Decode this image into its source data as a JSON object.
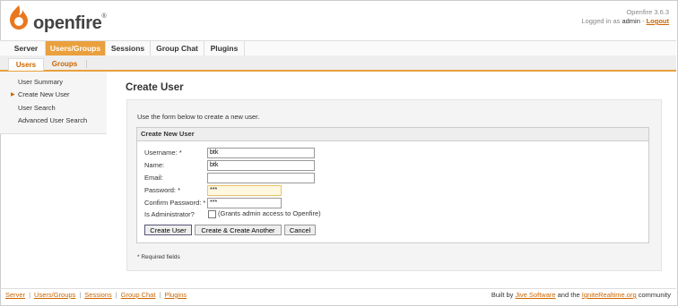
{
  "header": {
    "logo_text": "openfire",
    "logo_tm": "®",
    "version": "Openfire 3.6.3",
    "logged_in_prefix": "Logged in as",
    "user": "admin",
    "separator": "-",
    "logout": "Logout"
  },
  "tabs": [
    {
      "label": "Server"
    },
    {
      "label": "Users/Groups"
    },
    {
      "label": "Sessions"
    },
    {
      "label": "Group Chat"
    },
    {
      "label": "Plugins"
    }
  ],
  "subtabs": [
    {
      "label": "Users"
    },
    {
      "label": "Groups"
    }
  ],
  "sidebar": {
    "items": [
      {
        "label": "User Summary"
      },
      {
        "label": "Create New User"
      },
      {
        "label": "User Search"
      },
      {
        "label": "Advanced User Search"
      }
    ],
    "arrow": "▶"
  },
  "main": {
    "title": "Create User",
    "intro": "Use the form below to create a new user.",
    "box_title": "Create New User",
    "fields": {
      "username_label": "Username: *",
      "username_value": "btk",
      "name_label": "Name:",
      "name_value": "btk",
      "email_label": "Email:",
      "email_value": "",
      "password_label": "Password: *",
      "password_value": "***",
      "confirm_label": "Confirm Password: *",
      "confirm_value": "***",
      "admin_label": "Is Administrator?",
      "admin_hint": "(Grants admin access to Openfire)"
    },
    "buttons": {
      "create": "Create User",
      "create_another": "Create & Create Another",
      "cancel": "Cancel"
    },
    "required_note": "* Required fields"
  },
  "footer": {
    "links": [
      "Server",
      "Users/Groups",
      "Sessions",
      "Group Chat",
      "Plugins"
    ],
    "built_by": "Built by",
    "jive": "Jive Software",
    "and_the": "and the",
    "ignite": "IgniteRealtime.org",
    "community": "community"
  },
  "colors": {
    "accent": "#e9a03d",
    "link": "#cc6600"
  }
}
